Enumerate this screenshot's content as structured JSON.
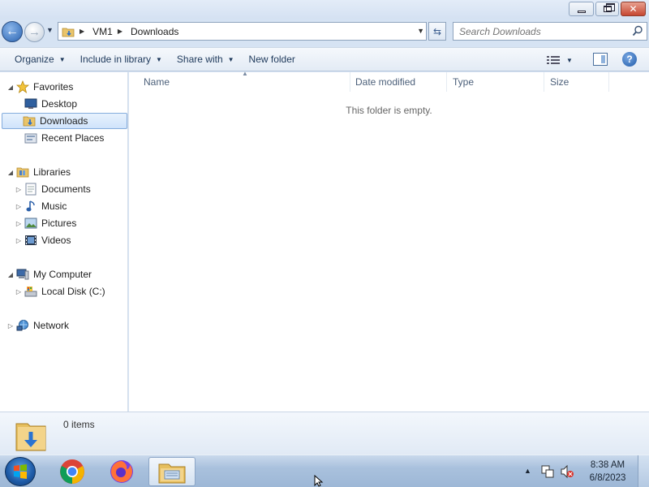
{
  "window": {
    "caption_buttons": {
      "minimize": "minimize",
      "maximize": "restore",
      "close": "close"
    }
  },
  "navbar": {
    "breadcrumb": [
      "VM1",
      "Downloads"
    ],
    "search_placeholder": "Search Downloads"
  },
  "toolbar": {
    "organize": "Organize",
    "include_in_library": "Include in library",
    "share_with": "Share with",
    "new_folder": "New folder"
  },
  "navpane": {
    "favorites": {
      "label": "Favorites",
      "items": [
        {
          "label": "Desktop",
          "icon": "desktop-icon"
        },
        {
          "label": "Downloads",
          "icon": "downloads-folder-icon",
          "selected": true
        },
        {
          "label": "Recent Places",
          "icon": "recent-places-icon"
        }
      ]
    },
    "libraries": {
      "label": "Libraries",
      "items": [
        {
          "label": "Documents",
          "icon": "documents-icon"
        },
        {
          "label": "Music",
          "icon": "music-icon"
        },
        {
          "label": "Pictures",
          "icon": "pictures-icon"
        },
        {
          "label": "Videos",
          "icon": "videos-icon"
        }
      ]
    },
    "computer": {
      "label": "My Computer",
      "items": [
        {
          "label": "Local Disk (C:)",
          "icon": "local-disk-icon"
        }
      ]
    },
    "network": {
      "label": "Network"
    }
  },
  "content": {
    "columns": [
      "Name",
      "Date modified",
      "Type",
      "Size"
    ],
    "empty_message": "This folder is empty."
  },
  "details": {
    "item_count": "0 items"
  },
  "taskbar": {
    "clock_time": "8:38 AM",
    "clock_date": "6/8/2023",
    "pinned": [
      "chrome-icon",
      "firefox-icon",
      "explorer-icon"
    ]
  },
  "colors": {
    "selection_bg": "#cfe3fb",
    "selection_border": "#84acdd",
    "toolbar_text": "#1e395b",
    "taskbar": "#a9c1dd"
  }
}
